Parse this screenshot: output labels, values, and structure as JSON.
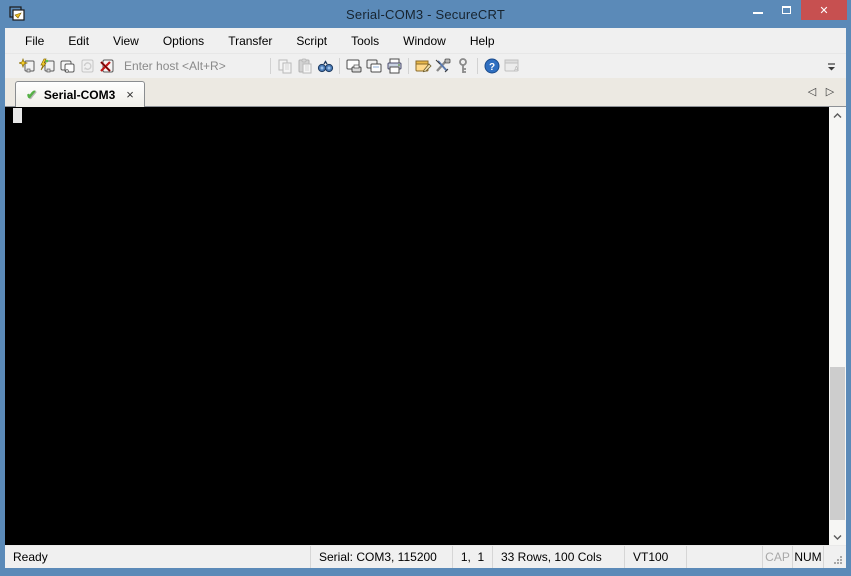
{
  "window": {
    "title": "Serial-COM3 - SecureCRT",
    "controls": {
      "close_glyph": "✕"
    }
  },
  "menu": {
    "items": [
      "File",
      "Edit",
      "View",
      "Options",
      "Transfer",
      "Script",
      "Tools",
      "Window",
      "Help"
    ]
  },
  "toolbar": {
    "host_placeholder": "Enter host <Alt+R>",
    "icons": [
      {
        "name": "quick-connect",
        "disabled": false
      },
      {
        "name": "connect",
        "disabled": false
      },
      {
        "name": "connect-in-tab",
        "disabled": false
      },
      {
        "name": "reconnect",
        "disabled": true
      },
      {
        "name": "disconnect",
        "disabled": false
      },
      {
        "name": "copy",
        "disabled": true
      },
      {
        "name": "paste",
        "disabled": true
      },
      {
        "name": "find",
        "disabled": false
      },
      {
        "name": "log-session",
        "disabled": false
      },
      {
        "name": "raw-log-session",
        "disabled": false
      },
      {
        "name": "print",
        "disabled": false
      },
      {
        "name": "session-options",
        "disabled": false
      },
      {
        "name": "global-options",
        "disabled": false
      },
      {
        "name": "keys",
        "disabled": false
      },
      {
        "name": "help",
        "disabled": false
      },
      {
        "name": "app-window",
        "disabled": true
      }
    ]
  },
  "tabs": {
    "active": {
      "label": "Serial-COM3",
      "close_glyph": "×"
    },
    "scroll_left_glyph": "◁",
    "scroll_right_glyph": "▷"
  },
  "status": {
    "ready": "Ready",
    "serial": "Serial: COM3, 115200",
    "position": "1,  1",
    "size": "33 Rows, 100 Cols",
    "emulation": "VT100",
    "cap": "CAP",
    "num": "NUM"
  },
  "colors": {
    "titlebar": "#5b8ab8",
    "close_button": "#c75050",
    "chrome_bg": "#f0f0f0",
    "tabbar_bg": "#ece9e2",
    "terminal_bg": "#000000",
    "tab_check_green": "#55b045",
    "scrollbar_thumb": "#cdcdcd"
  }
}
